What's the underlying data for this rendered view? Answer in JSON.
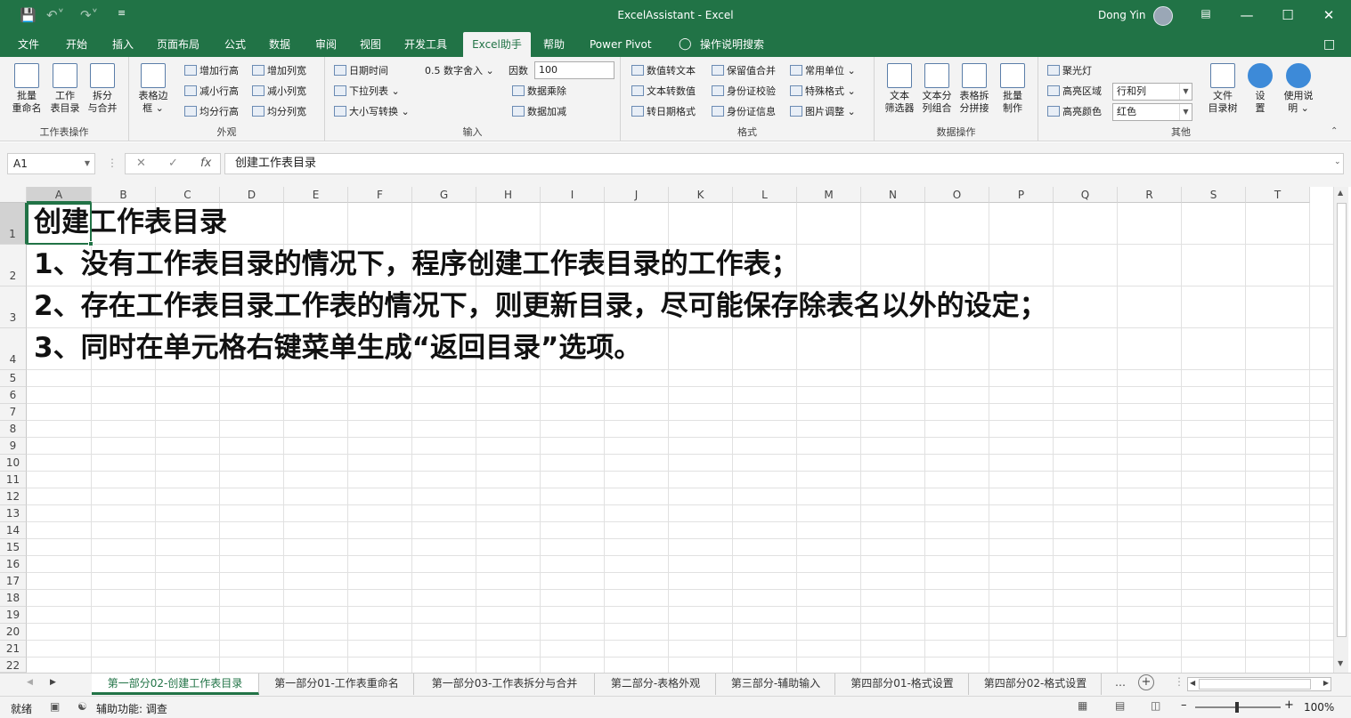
{
  "titlebar": {
    "title": "ExcelAssistant  -  Excel",
    "user": "Dong Yin"
  },
  "tabs": [
    "文件",
    "开始",
    "插入",
    "页面布局",
    "公式",
    "数据",
    "审阅",
    "视图",
    "开发工具",
    "Excel助手",
    "帮助",
    "Power Pivot",
    "操作说明搜索"
  ],
  "active_tab": "Excel助手",
  "ribbon": {
    "ws": {
      "label": "工作表操作",
      "b1": "批量\n重命名",
      "b2": "工作\n表目录",
      "b3": "拆分\n与合并"
    },
    "look": {
      "label": "外观",
      "big": "表格边\n框 ⌄",
      "s1": "增加行高",
      "s2": "增加列宽",
      "s3": "减小行高",
      "s4": "减小列宽",
      "s5": "均分行高",
      "s6": "均分列宽"
    },
    "input": {
      "label": "输入",
      "s1": "日期时间",
      "s2": "下拉列表 ⌄",
      "s3": "大小写转换 ⌄",
      "s4": "0.5 数字舍入 ⌄",
      "factor_label": "因数",
      "factor_value": "100",
      "s5": "数据乘除",
      "s6": "数据加减"
    },
    "fmt": {
      "label": "格式",
      "s1": "数值转文本",
      "s2": "文本转数值",
      "s3": "转日期格式",
      "s4": "保留值合并",
      "s5": "身份证校验",
      "s6": "身份证信息",
      "s7": "常用单位 ⌄",
      "s8": "特殊格式 ⌄",
      "s9": "图片调整 ⌄"
    },
    "data": {
      "label": "数据操作",
      "b1": "文本\n筛选器",
      "b2": "文本分\n列组合",
      "b3": "表格拆\n分拼接",
      "b4": "批量\n制作"
    },
    "other": {
      "label": "其他",
      "spot": "聚光灯",
      "area_label": "高亮区域",
      "area_value": "行和列",
      "color_label": "高亮颜色",
      "color_value": "红色",
      "b1": "文件\n目录树",
      "b2": "设\n置",
      "b3": "使用说\n明 ⌄"
    }
  },
  "formula_bar": {
    "name_box": "A1",
    "fx": "fx",
    "value": "创建工作表目录"
  },
  "columns": [
    "A",
    "B",
    "C",
    "D",
    "E",
    "F",
    "G",
    "H",
    "I",
    "J",
    "K",
    "L",
    "M",
    "N",
    "O",
    "P",
    "Q",
    "R",
    "S",
    "T"
  ],
  "rows": [
    "1",
    "2",
    "3",
    "4",
    "5",
    "6",
    "7",
    "8",
    "9",
    "10",
    "11",
    "12",
    "13",
    "14",
    "15",
    "16",
    "17",
    "18",
    "19",
    "20",
    "21",
    "22"
  ],
  "cells": [
    "创建工作表目录",
    "1、没有工作表目录的情况下，程序创建工作表目录的工作表；",
    "2、存在工作表目录工作表的情况下，则更新目录，尽可能保存除表名以外的设定；",
    "3、同时在单元格右键菜单生成“返回目录”选项。"
  ],
  "sheet_tabs": [
    "第一部分02-创建工作表目录",
    "第一部分01-工作表重命名",
    "第一部分03-工作表拆分与合并",
    "第二部分-表格外观",
    "第三部分-辅助输入",
    "第四部分01-格式设置",
    "第四部分02-格式设置"
  ],
  "status": {
    "ready": "就绪",
    "accessibility": "辅助功能: 调查",
    "zoom": "100%"
  },
  "colors": {
    "brand": "#217346"
  }
}
